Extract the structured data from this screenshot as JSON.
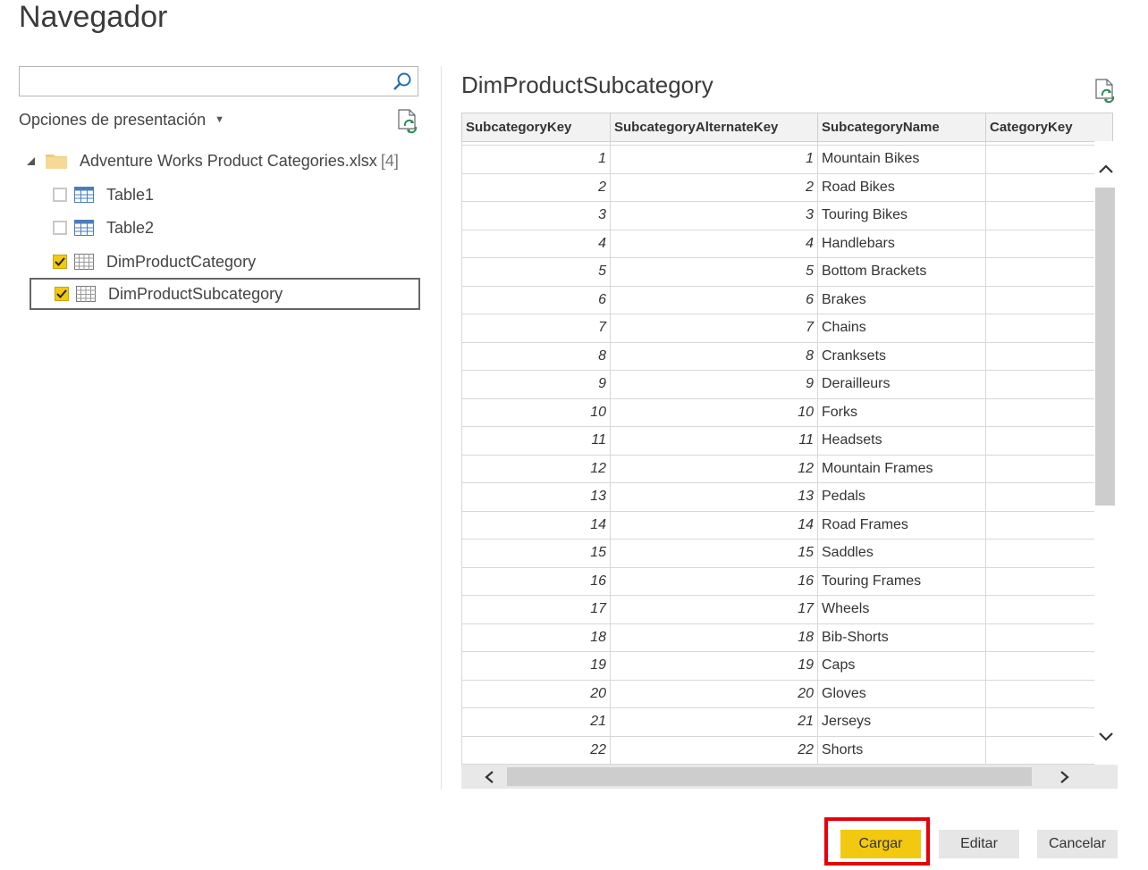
{
  "window": {
    "title": "Navegador"
  },
  "search": {
    "value": "",
    "placeholder": "",
    "icon": "search-icon"
  },
  "display_options": {
    "label": "Opciones de presentación"
  },
  "tree": {
    "root": {
      "label": "Adventure Works Product Categories.xlsx",
      "count": "[4]"
    },
    "items": [
      {
        "label": "Table1",
        "checked": false,
        "selected": false
      },
      {
        "label": "Table2",
        "checked": false,
        "selected": false
      },
      {
        "label": "DimProductCategory",
        "checked": true,
        "selected": false
      },
      {
        "label": "DimProductSubcategory",
        "checked": true,
        "selected": true
      }
    ]
  },
  "preview": {
    "title": "DimProductSubcategory",
    "columns": [
      "SubcategoryKey",
      "SubcategoryAlternateKey",
      "SubcategoryName",
      "CategoryKey"
    ],
    "rows": [
      [
        "1",
        "1",
        "Mountain Bikes",
        ""
      ],
      [
        "2",
        "2",
        "Road Bikes",
        ""
      ],
      [
        "3",
        "3",
        "Touring Bikes",
        ""
      ],
      [
        "4",
        "4",
        "Handlebars",
        ""
      ],
      [
        "5",
        "5",
        "Bottom Brackets",
        ""
      ],
      [
        "6",
        "6",
        "Brakes",
        ""
      ],
      [
        "7",
        "7",
        "Chains",
        ""
      ],
      [
        "8",
        "8",
        "Cranksets",
        ""
      ],
      [
        "9",
        "9",
        "Derailleurs",
        ""
      ],
      [
        "10",
        "10",
        "Forks",
        ""
      ],
      [
        "11",
        "11",
        "Headsets",
        ""
      ],
      [
        "12",
        "12",
        "Mountain Frames",
        ""
      ],
      [
        "13",
        "13",
        "Pedals",
        ""
      ],
      [
        "14",
        "14",
        "Road Frames",
        ""
      ],
      [
        "15",
        "15",
        "Saddles",
        ""
      ],
      [
        "16",
        "16",
        "Touring Frames",
        ""
      ],
      [
        "17",
        "17",
        "Wheels",
        ""
      ],
      [
        "18",
        "18",
        "Bib-Shorts",
        ""
      ],
      [
        "19",
        "19",
        "Caps",
        ""
      ],
      [
        "20",
        "20",
        "Gloves",
        ""
      ],
      [
        "21",
        "21",
        "Jerseys",
        ""
      ],
      [
        "22",
        "22",
        "Shorts",
        ""
      ]
    ]
  },
  "buttons": {
    "load": "Cargar",
    "edit": "Editar",
    "cancel": "Cancelar"
  },
  "colors": {
    "accent": "#f2c811",
    "highlight": "#e8000b",
    "button_gray": "#e6e6e6"
  }
}
